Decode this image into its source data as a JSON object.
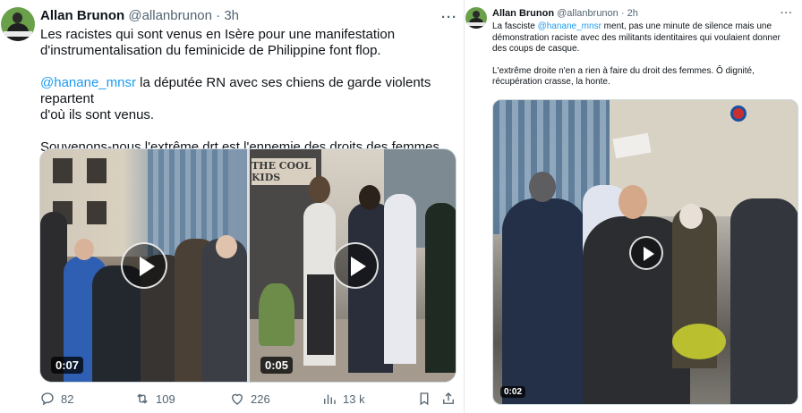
{
  "left_tweet": {
    "author_name": "Allan Brunon",
    "handle": "@allanbrunon",
    "separator": "·",
    "time": "3h",
    "more": "···",
    "lines": {
      "l1": "Les racistes qui sont venus en Isère pour une manifestation",
      "l2": "d'instrumentalisation du feminicide de Philippine font flop.",
      "mention": "@hanane_mnsr",
      "l3_rest": " la députée RN avec ses chiens de garde violents repartent",
      "l4": "d'où ils sont venus.",
      "l5": "Souvenons-nous l'extrême drt est l'ennemie des droits des femmes"
    },
    "videos": [
      {
        "duration": "0:07"
      },
      {
        "duration": "0:05",
        "sign_text": "THE COOL KIDS"
      }
    ],
    "actions": {
      "replies": "82",
      "reposts": "109",
      "likes": "226",
      "views": "13 k"
    }
  },
  "right_tweet": {
    "author_name": "Allan Brunon",
    "handle": "@allanbrunon",
    "separator": "·",
    "time": "2h",
    "more": "···",
    "lines": {
      "p1_start": "La fasciste ",
      "mention": "@hanane_mnsr",
      "p1_rest": " ment, pas une minute de silence mais une",
      "p1_l2": "démonstration raciste avec des militants identitaires qui voulaient donner",
      "p1_l3": "des coups de casque.",
      "p2_l1": "L'extrême droite n'en a rien à faire du droit des femmes. Ô dignité,",
      "p2_l2": "récupération crasse, la honte."
    },
    "video": {
      "duration": "0:02"
    }
  },
  "colors": {
    "text": "#0f1419",
    "secondary": "#536471",
    "link": "#1d9bf0",
    "border": "#cfd9de"
  }
}
